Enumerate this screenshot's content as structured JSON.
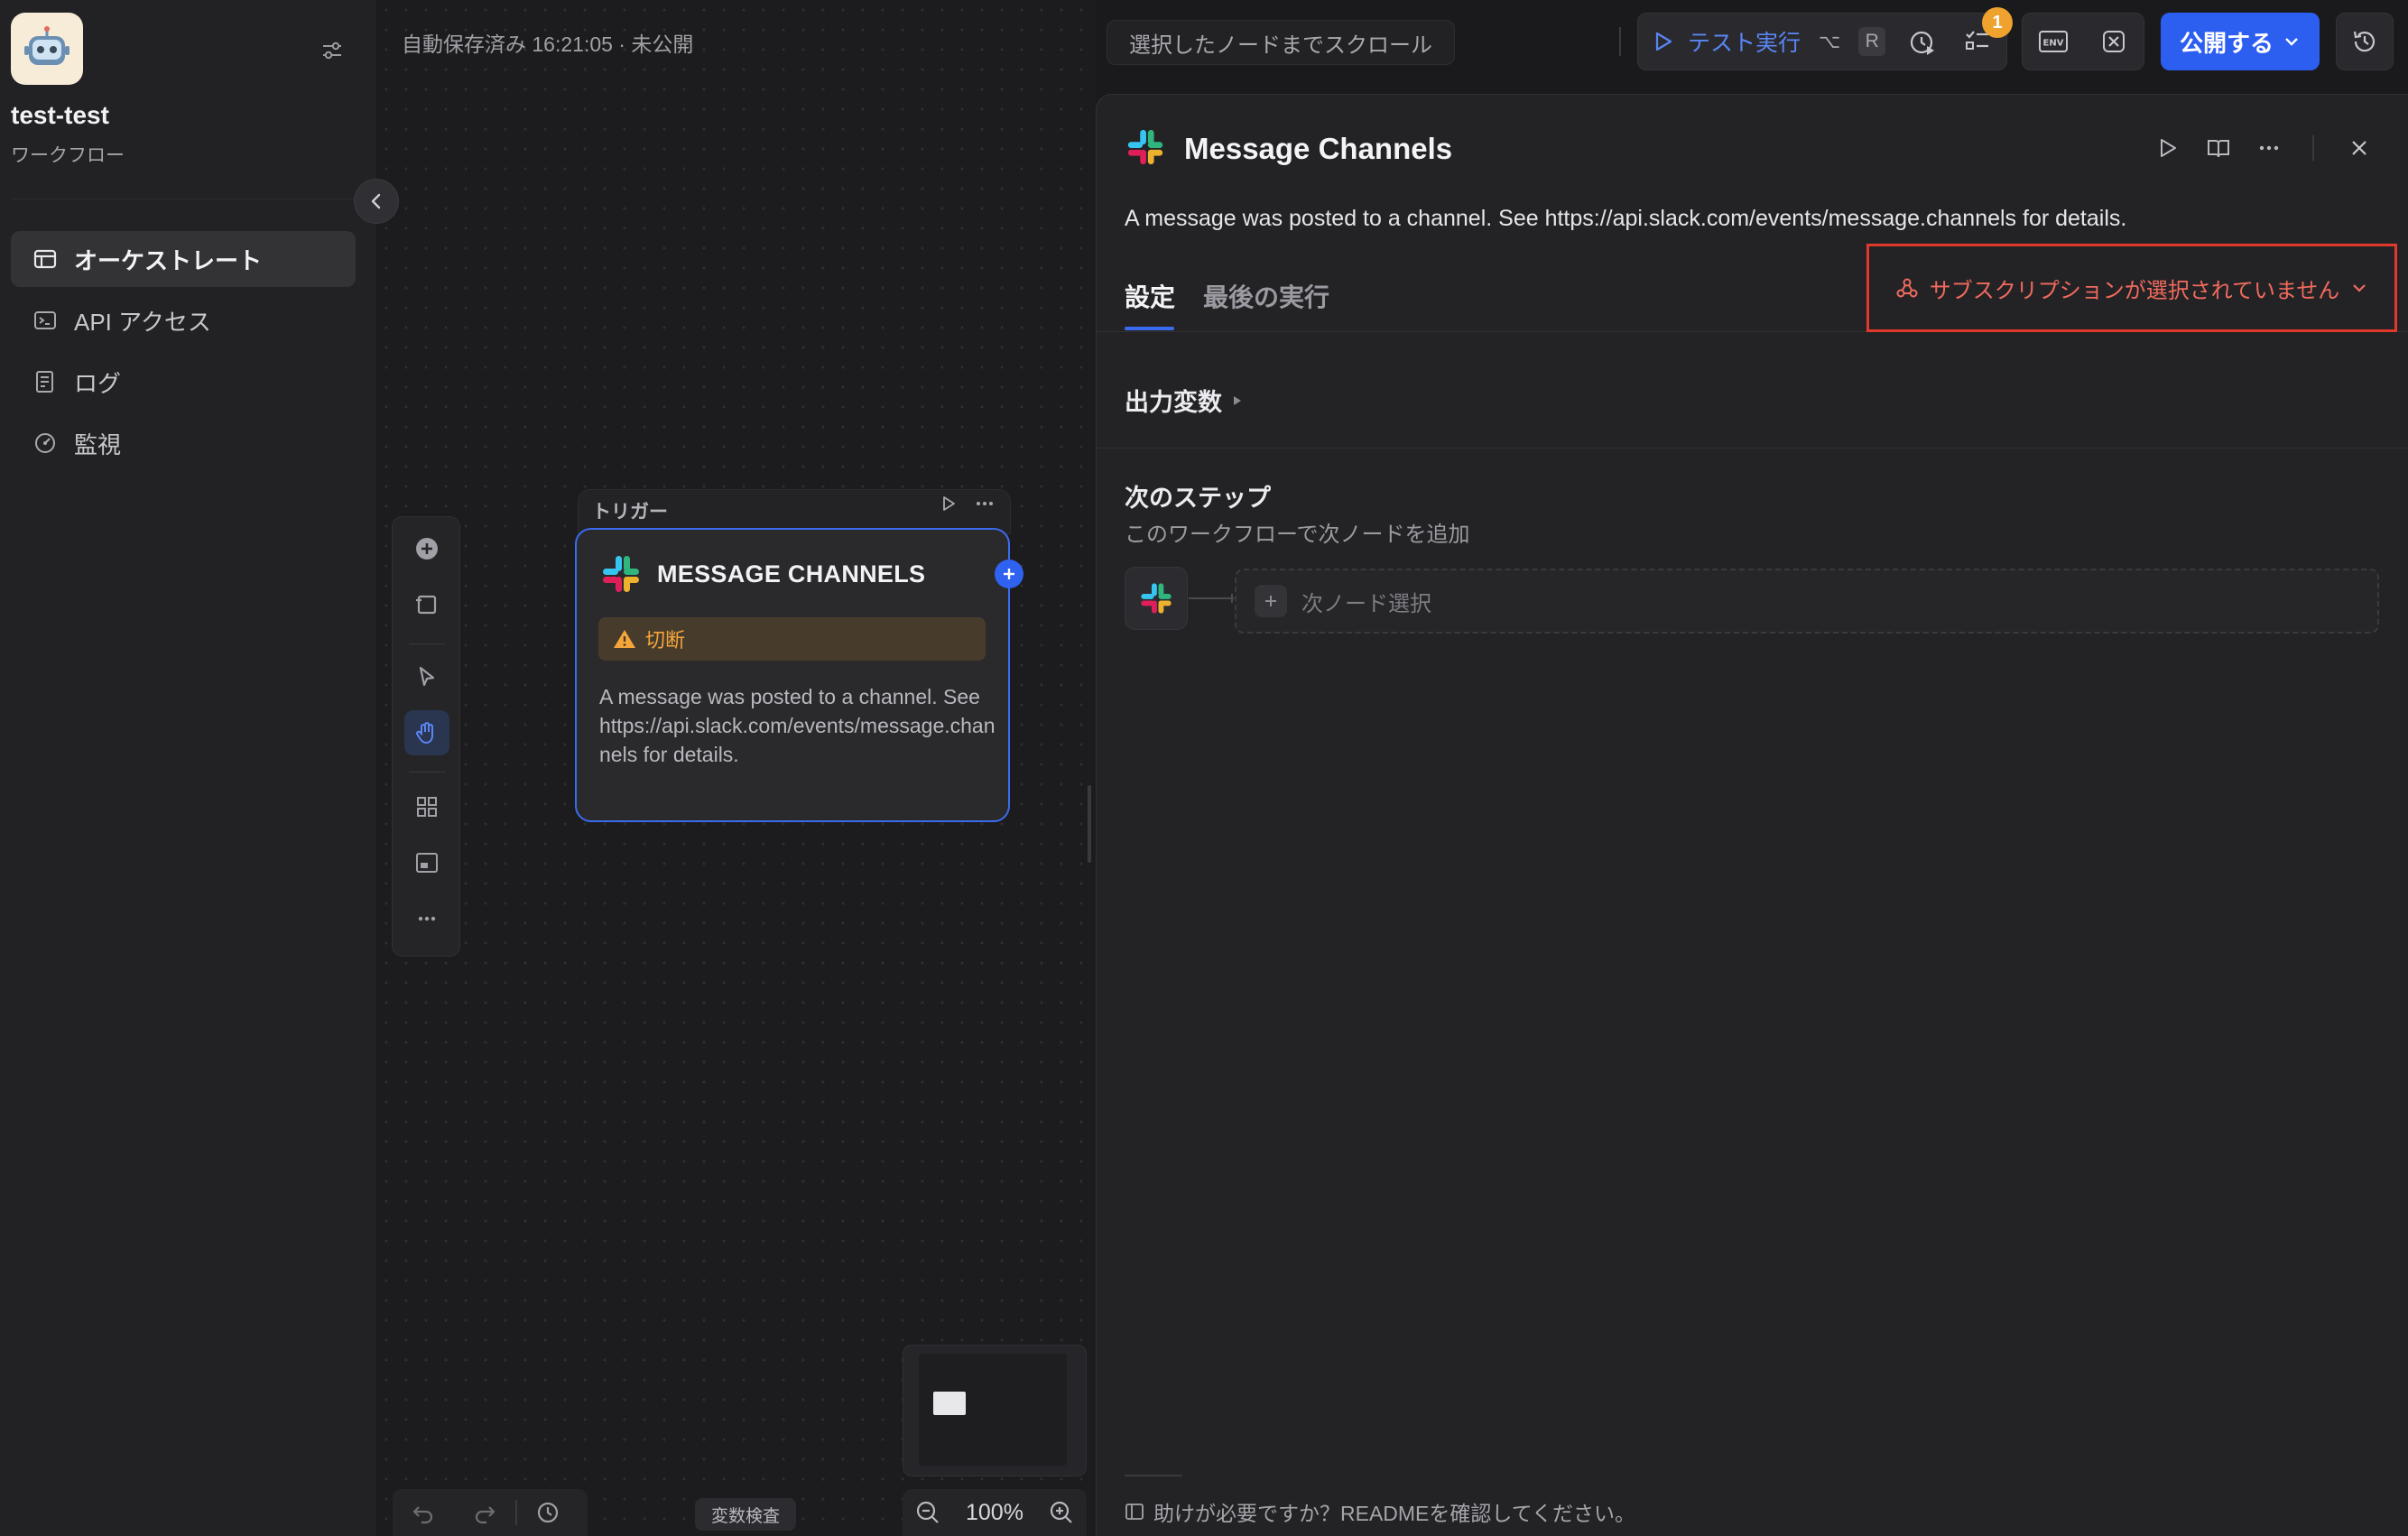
{
  "app": {
    "name": "test-test",
    "kind": "ワークフロー",
    "avatar_icon": "robot-icon"
  },
  "sidebar": {
    "items": [
      {
        "label": "オーケストレート",
        "icon": "workflow-icon",
        "active": true
      },
      {
        "label": "API アクセス",
        "icon": "terminal-icon",
        "active": false
      },
      {
        "label": "ログ",
        "icon": "log-icon",
        "active": false
      },
      {
        "label": "監視",
        "icon": "gauge-icon",
        "active": false
      }
    ]
  },
  "header": {
    "status": "自動保存済み 16:21:05 · 未公開",
    "scroll_label": "選択したノードまでスクロール",
    "test_run_label": "テスト実行",
    "shortcut_keys": [
      "⌥",
      "R"
    ],
    "badge_count": "1",
    "env_label": "ENV",
    "publish_label": "公開する"
  },
  "canvas": {
    "node": {
      "tab_label": "トリガー",
      "title": "MESSAGE CHANNELS",
      "warning": "切断",
      "description": "A message was posted to a channel. See https://api.slack.com/events/message.channels for details."
    },
    "zoom": "100%",
    "var_inspect_label": "変数検査"
  },
  "panel": {
    "title": "Message Channels",
    "description": "A message was posted to a channel. See https://api.slack.com/events/message.channels for details.",
    "tabs": [
      {
        "label": "設定",
        "active": true
      },
      {
        "label": "最後の実行",
        "active": false
      }
    ],
    "subscription_label": "サブスクリプションが選択されていません",
    "output_vars_label": "出力変数",
    "next_step": {
      "title": "次のステップ",
      "subtitle": "このワークフローで次ノードを追加",
      "select_label": "次ノード選択"
    },
    "help_text": "助けが必要ですか？READMEを確認してください。"
  },
  "colors": {
    "accent": "#2c5ef0",
    "warning": "#f5a53a",
    "error": "#e0392b",
    "badge": "#f0a22e"
  }
}
